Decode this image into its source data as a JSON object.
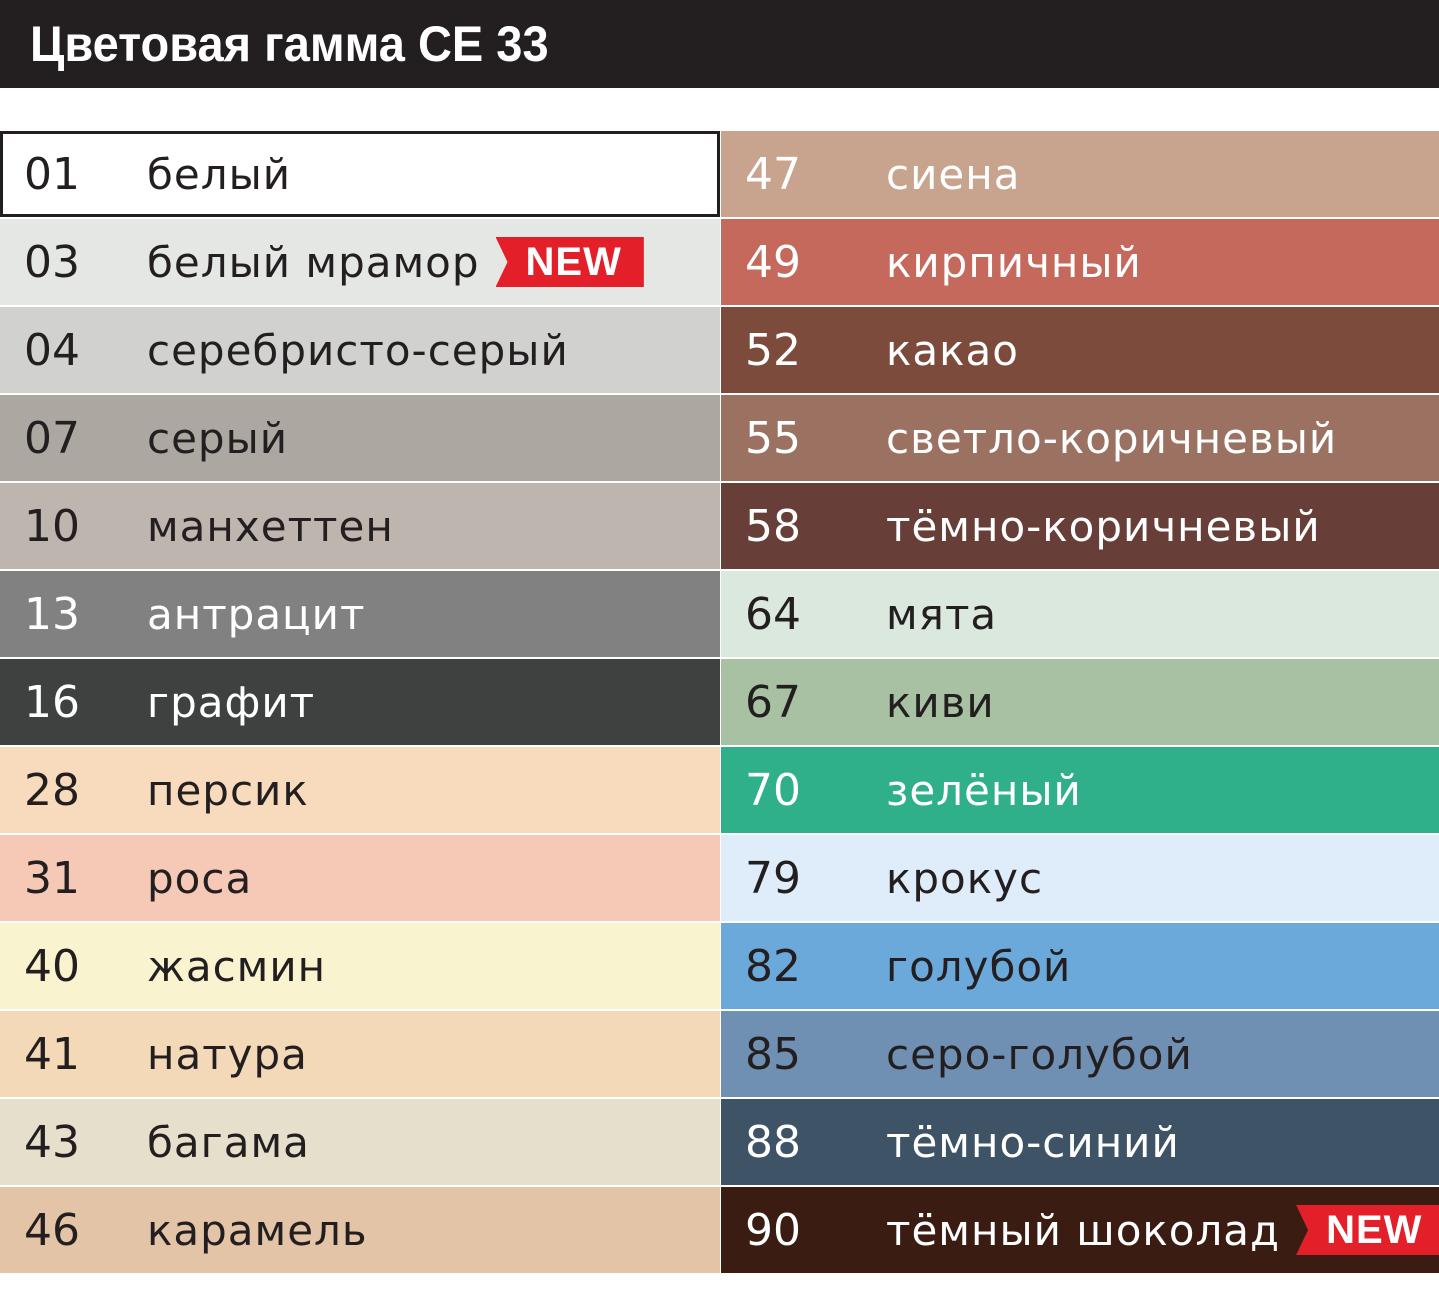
{
  "header": {
    "title": "Цветовая гамма CE 33"
  },
  "left_column": [
    {
      "code": "01",
      "name": "белый",
      "bg": "#ffffff",
      "fg": "#231f20",
      "badge": ""
    },
    {
      "code": "03",
      "name": "белый мрамор",
      "bg": "#e5e7e5",
      "fg": "#231f20",
      "badge": "NEW"
    },
    {
      "code": "04",
      "name": "серебристо-серый",
      "bg": "#d1d1cf",
      "fg": "#231f20",
      "badge": ""
    },
    {
      "code": "07",
      "name": "серый",
      "bg": "#aca8a1",
      "fg": "#231f20",
      "badge": ""
    },
    {
      "code": "10",
      "name": "манхеттен",
      "bg": "#bdb5ae",
      "fg": "#231f20",
      "badge": ""
    },
    {
      "code": "13",
      "name": "антрацит",
      "bg": "#818181",
      "fg": "#ffffff",
      "badge": ""
    },
    {
      "code": "16",
      "name": "графит",
      "bg": "#3f4040",
      "fg": "#ffffff",
      "badge": ""
    },
    {
      "code": "28",
      "name": "персик",
      "bg": "#f8dbbd",
      "fg": "#231f20",
      "badge": ""
    },
    {
      "code": "31",
      "name": "роса",
      "bg": "#f6c8b6",
      "fg": "#231f20",
      "badge": ""
    },
    {
      "code": "40",
      "name": "жасмин",
      "bg": "#f9f3cf",
      "fg": "#231f20",
      "badge": ""
    },
    {
      "code": "41",
      "name": "натура",
      "bg": "#f4d9b9",
      "fg": "#231f20",
      "badge": ""
    },
    {
      "code": "43",
      "name": "багама",
      "bg": "#e6dfcb",
      "fg": "#231f20",
      "badge": ""
    },
    {
      "code": "46",
      "name": "карамель",
      "bg": "#e3c4a6",
      "fg": "#231f20",
      "badge": ""
    }
  ],
  "right_column": [
    {
      "code": "47",
      "name": "сиена",
      "bg": "#c8a48f",
      "fg": "#ffffff",
      "badge": ""
    },
    {
      "code": "49",
      "name": "кирпичный",
      "bg": "#c4695c",
      "fg": "#ffffff",
      "badge": ""
    },
    {
      "code": "52",
      "name": "какао",
      "bg": "#7c4b3c",
      "fg": "#ffffff",
      "badge": ""
    },
    {
      "code": "55",
      "name": "светло-коричневый",
      "bg": "#9b7262",
      "fg": "#ffffff",
      "badge": ""
    },
    {
      "code": "58",
      "name": "тёмно-коричневый",
      "bg": "#673f38",
      "fg": "#ffffff",
      "badge": ""
    },
    {
      "code": "64",
      "name": "мята",
      "bg": "#dbe8dd",
      "fg": "#231f20",
      "badge": ""
    },
    {
      "code": "67",
      "name": "киви",
      "bg": "#a8c1a3",
      "fg": "#231f20",
      "badge": ""
    },
    {
      "code": "70",
      "name": "зелёный",
      "bg": "#2fb08a",
      "fg": "#ffffff",
      "badge": ""
    },
    {
      "code": "79",
      "name": "крокус",
      "bg": "#deedf9",
      "fg": "#231f20",
      "badge": ""
    },
    {
      "code": "82",
      "name": "голубой",
      "bg": "#6ca9db",
      "fg": "#231f20",
      "badge": ""
    },
    {
      "code": "85",
      "name": "серо-голубой",
      "bg": "#6f90b3",
      "fg": "#231f20",
      "badge": ""
    },
    {
      "code": "88",
      "name": "тёмно-синий",
      "bg": "#3e5366",
      "fg": "#ffffff",
      "badge": ""
    },
    {
      "code": "90",
      "name": "тёмный шоколад",
      "bg": "#3a1c12",
      "fg": "#ffffff",
      "badge": "NEW"
    }
  ],
  "colors": {
    "header_bg": "#231f20",
    "badge_bg": "#e3202a"
  }
}
